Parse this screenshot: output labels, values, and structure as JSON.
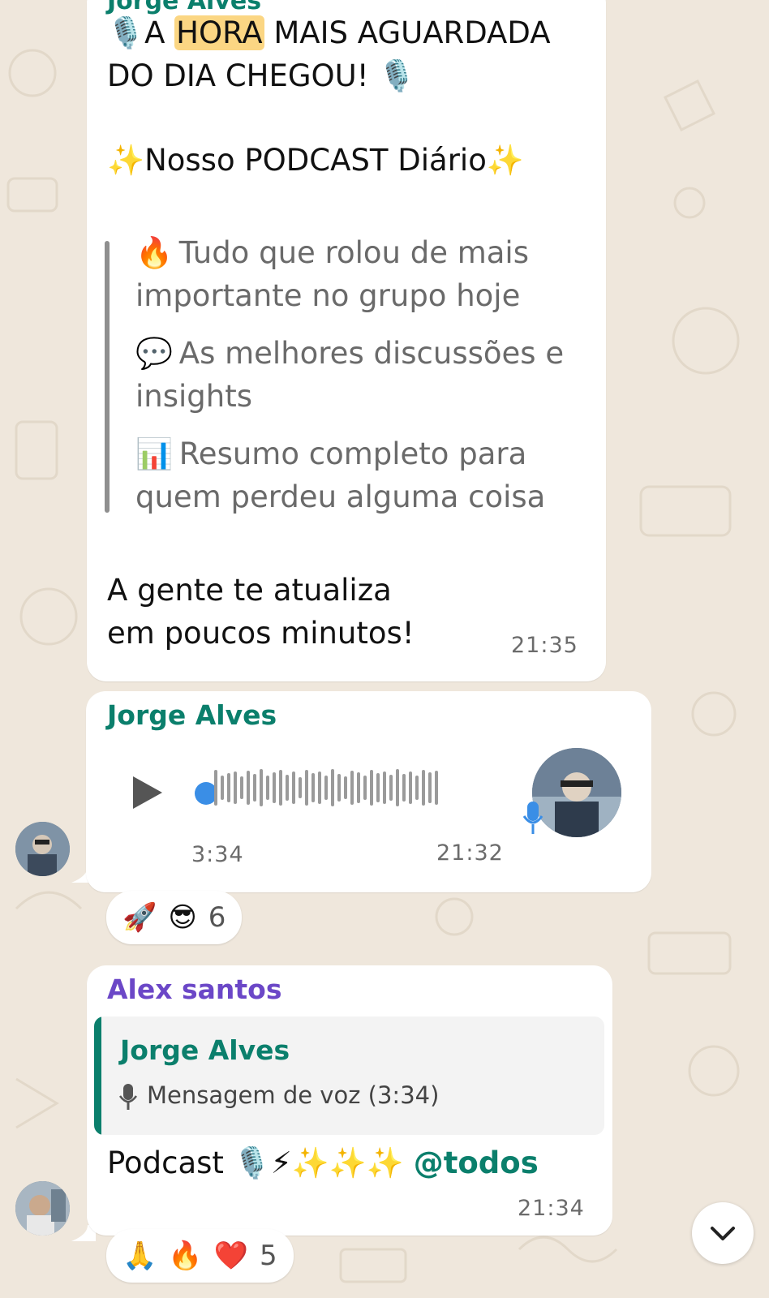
{
  "colors": {
    "background": "#efe7dc",
    "bubble": "#ffffff",
    "sender_teal": "#0b7f6c",
    "sender_purple": "#6b47c7",
    "highlight": "#fbd683",
    "quote_text": "#6a6a6a",
    "audio_dot": "#3a8ee6"
  },
  "message_podcast": {
    "sender": "Jorge Alves",
    "line1_emoji": "🎙️",
    "line1_pre": "A ",
    "line1_highlight": "HORA",
    "line1_post": " MAIS AGUARDADA",
    "line2": "DO DIA CHEGOU! 🎙️",
    "line3": "✨Nosso PODCAST Diário✨",
    "bullets": [
      {
        "icon": "🔥",
        "line1": "Tudo que rolou de mais",
        "line2": "importante no grupo hoje"
      },
      {
        "icon": "💬",
        "line1": "As melhores discussões e",
        "line2": "insights"
      },
      {
        "icon": "📊",
        "line1": "Resumo completo para",
        "line2": "quem perdeu alguma coisa"
      }
    ],
    "closing_line1": "A gente te atualiza",
    "closing_line2": "em poucos minutos!",
    "time": "21:35"
  },
  "message_voice": {
    "sender": "Jorge Alves",
    "duration": "3:34",
    "time": "21:32",
    "progress": 0,
    "reactions": {
      "emojis": [
        "🚀",
        "😎"
      ],
      "count": "6"
    }
  },
  "message_reply": {
    "sender": "Alex santos",
    "quoted_sender": "Jorge Alves",
    "quoted_text": "Mensagem de voz (3:34)",
    "text": "Podcast 🎙️⚡✨✨✨ ",
    "mention": "@todos",
    "time": "21:34",
    "reactions": {
      "emojis": [
        "🙏",
        "🔥",
        "❤️"
      ],
      "count": "5"
    }
  },
  "scroll_button": {
    "icon": "chevron-down-icon"
  }
}
